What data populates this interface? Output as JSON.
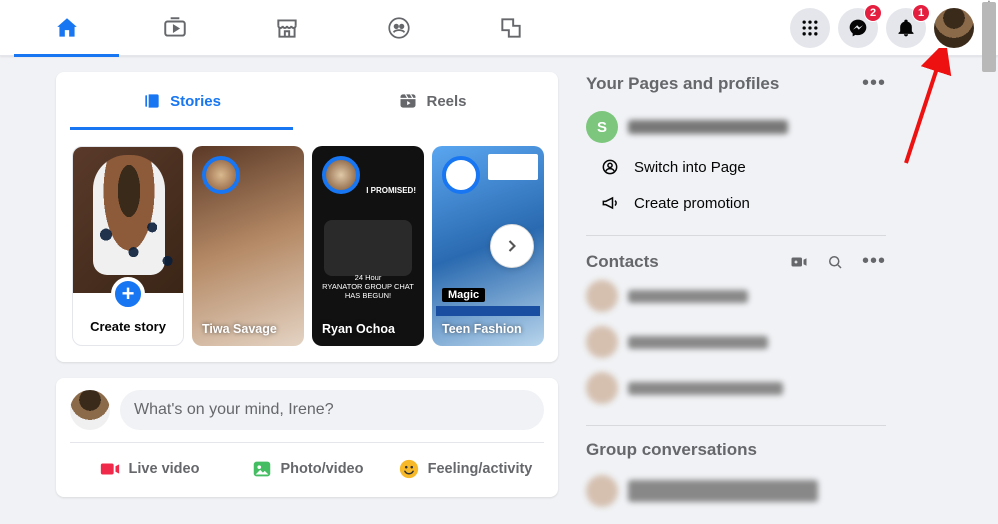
{
  "nav": {
    "badges": {
      "messenger": "2",
      "notifications": "1"
    }
  },
  "stories": {
    "tabs": {
      "stories": "Stories",
      "reels": "Reels"
    },
    "create_label": "Create story",
    "items": [
      {
        "name": "Tiwa Savage"
      },
      {
        "name": "Ryan Ochoa"
      },
      {
        "name": "Teen Fashion",
        "caption": "Magic"
      }
    ]
  },
  "composer": {
    "placeholder": "What's on your mind, Irene?",
    "live": "Live video",
    "photo": "Photo/video",
    "feeling": "Feeling/activity"
  },
  "pages": {
    "title": "Your Pages and profiles",
    "letter": "S",
    "switch": "Switch into Page",
    "promote": "Create promotion"
  },
  "contacts": {
    "title": "Contacts"
  },
  "groupconv": {
    "title": "Group conversations"
  }
}
